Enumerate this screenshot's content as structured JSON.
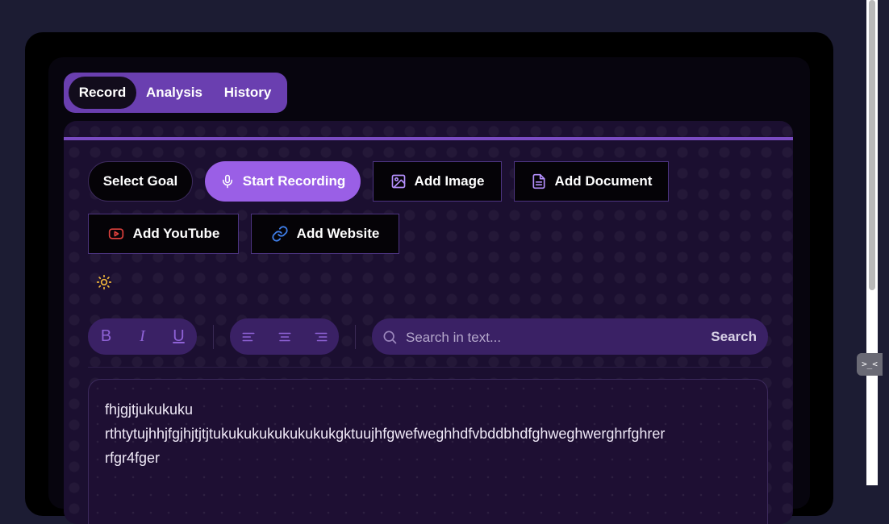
{
  "tabs": [
    {
      "label": "Record",
      "active": true
    },
    {
      "label": "Analysis",
      "active": false
    },
    {
      "label": "History",
      "active": false
    }
  ],
  "actions": {
    "select_goal": "Select Goal",
    "start_recording": "Start Recording",
    "add_image": "Add Image",
    "add_document": "Add Document",
    "add_youtube": "Add YouTube",
    "add_website": "Add Website"
  },
  "toolbar": {
    "bold": "B",
    "italic": "I",
    "underline": "U",
    "align_icons": [
      "align-left-icon",
      "align-center-icon",
      "align-right-icon"
    ]
  },
  "search": {
    "placeholder": "Search in text...",
    "button_label": "Search"
  },
  "editor": {
    "lines": [
      "fhjgjtjukukuku",
      "rthtytujhhjfgjhjtjtjtukukukukukukukukgktuujhfgwefweghhdfvbddbhdfghweghwerghrfghrer",
      "rfgr4fger"
    ]
  },
  "side_tab": {
    "label": ">_<"
  },
  "colors": {
    "accent": "#9a5fe6",
    "tab_bar": "#6a3fb0",
    "youtube_icon": "#e0413d",
    "website_icon": "#3f7ee8",
    "sun_icon": "#f2b83a"
  }
}
